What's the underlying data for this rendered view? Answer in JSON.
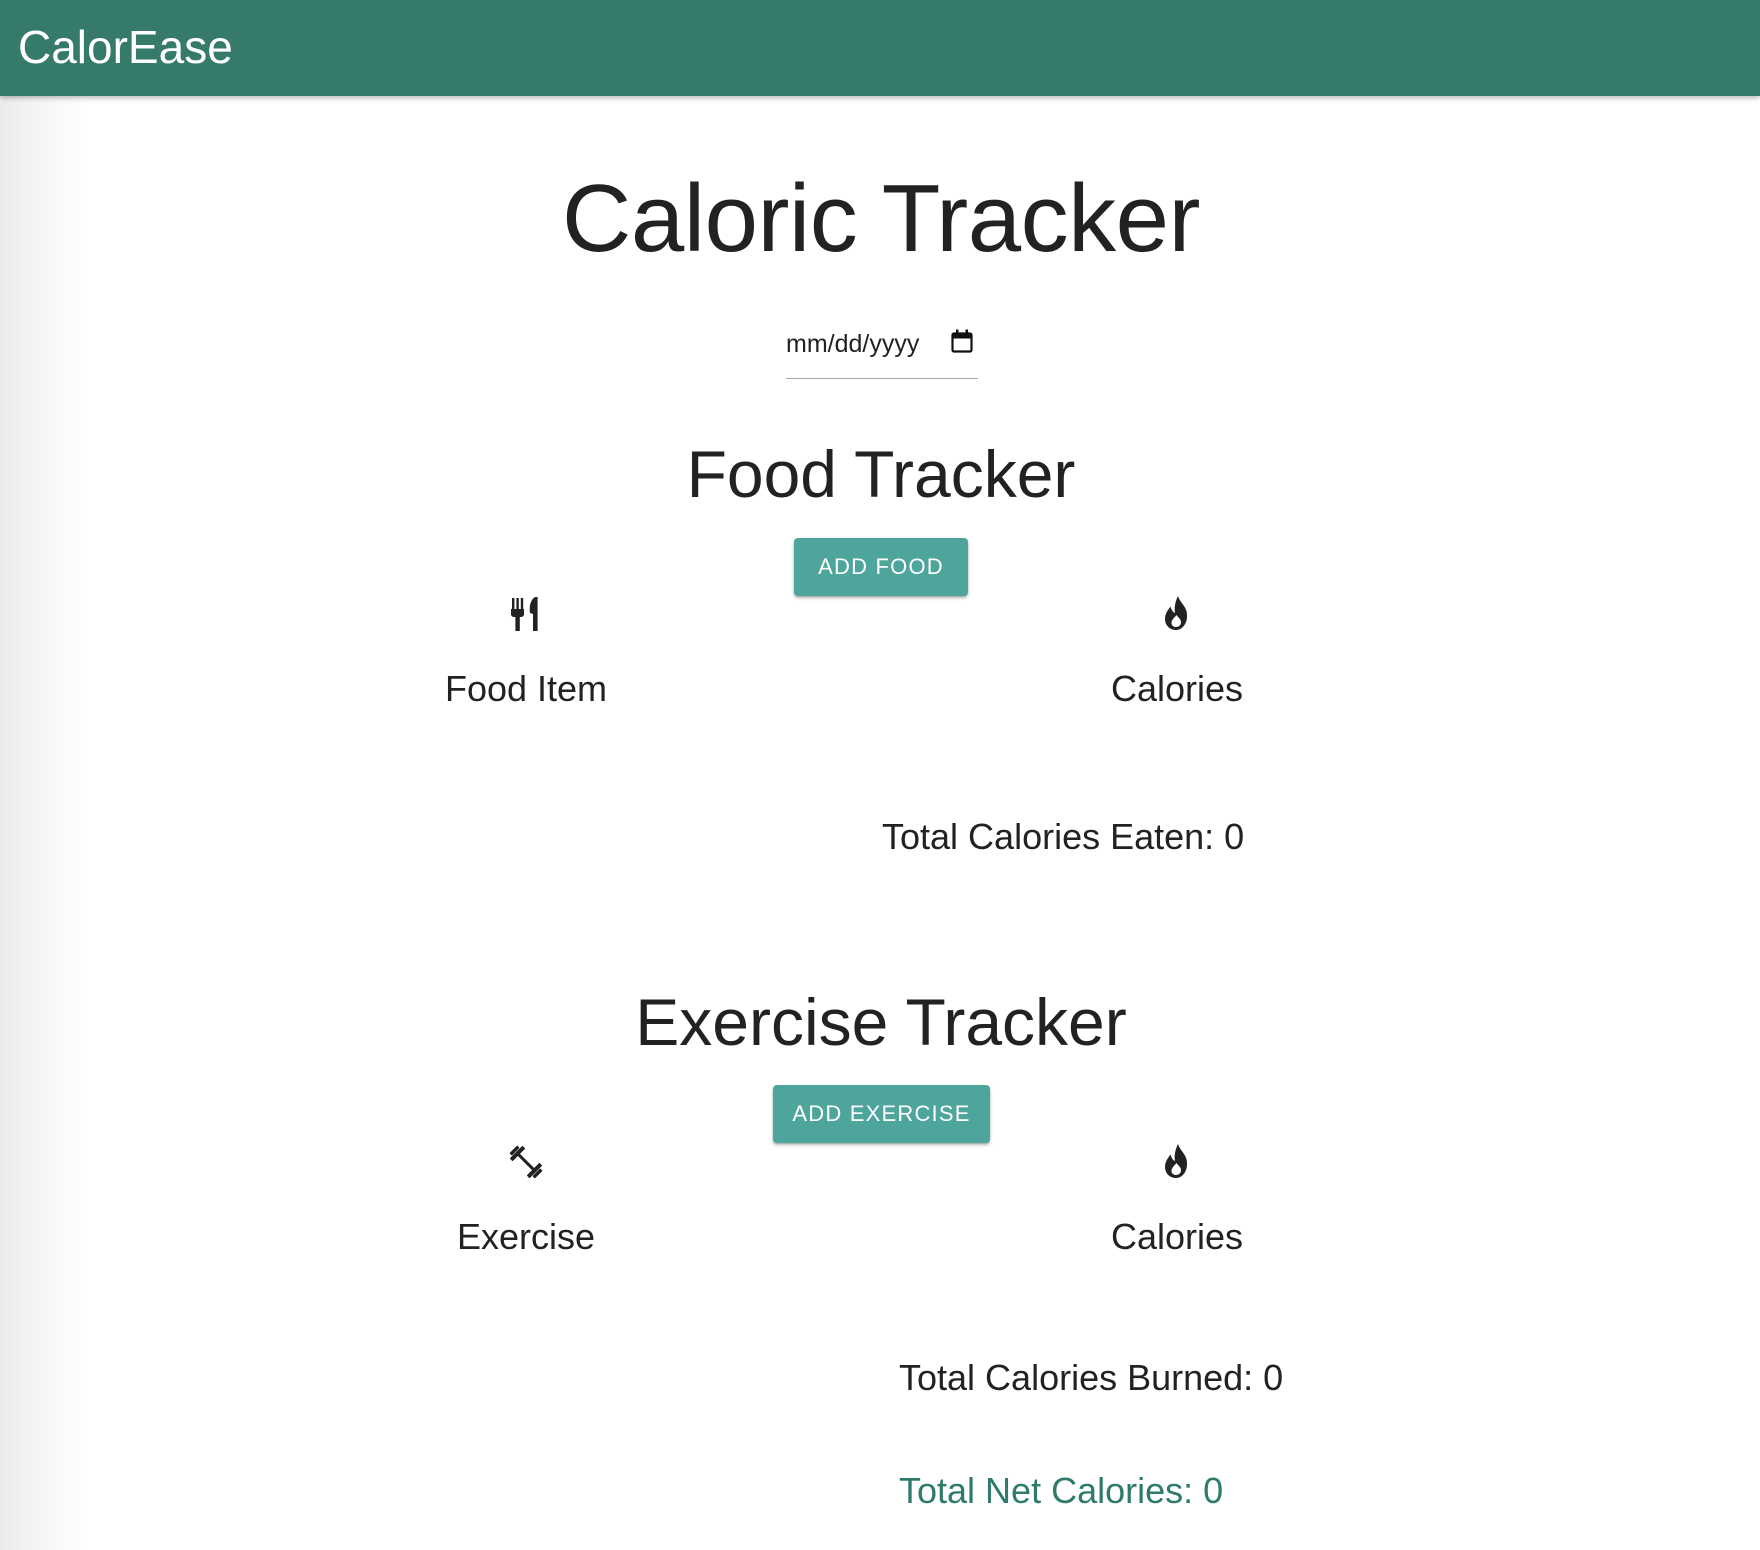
{
  "app": {
    "title": "CalorEase",
    "bar_color": "#367a6c"
  },
  "main": {
    "title": "Caloric Tracker",
    "date_input": {
      "value": "mm/dd/yyyy",
      "icon": "calendar-icon"
    }
  },
  "food": {
    "title": "Food Tracker",
    "add_button": "ADD FOOD",
    "columns": [
      {
        "label": "Food Item",
        "icon": "fork-knife-icon"
      },
      {
        "label": "Calories",
        "icon": "fire-icon"
      }
    ],
    "total": "Total Calories Eaten: 0"
  },
  "exercise": {
    "title": "Exercise Tracker",
    "add_button": "ADD EXERCISE",
    "columns": [
      {
        "label": "Exercise",
        "icon": "dumbbell-icon"
      },
      {
        "label": "Calories",
        "icon": "fire-icon"
      }
    ],
    "total": "Total Calories Burned: 0"
  },
  "net": {
    "total": "Total Net Calories: 0",
    "color": "#2f7b6b"
  },
  "colors": {
    "button": "#4da59b",
    "text": "#222222"
  }
}
